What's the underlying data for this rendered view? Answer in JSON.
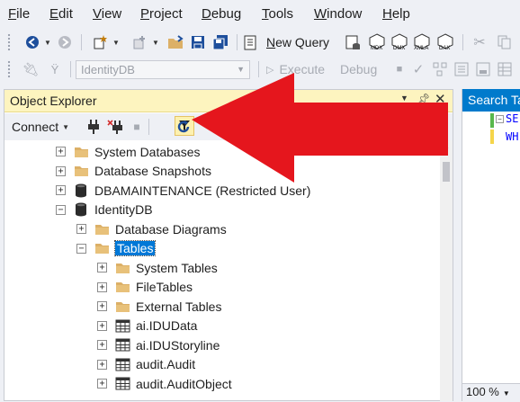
{
  "menu": [
    {
      "label": "File",
      "mnemonic": "F",
      "rest": "ile"
    },
    {
      "label": "Edit",
      "mnemonic": "E",
      "rest": "dit"
    },
    {
      "label": "View",
      "mnemonic": "V",
      "rest": "iew"
    },
    {
      "label": "Project",
      "mnemonic": "P",
      "rest": "roject"
    },
    {
      "label": "Debug",
      "mnemonic": "D",
      "rest": "ebug"
    },
    {
      "label": "Tools",
      "mnemonic": "T",
      "rest": "ools"
    },
    {
      "label": "Window",
      "mnemonic": "W",
      "rest": "indow"
    },
    {
      "label": "Help",
      "mnemonic": "H",
      "rest": "elp"
    }
  ],
  "toolbar1": {
    "new_query": "New Query",
    "new_query_mnemonic": "N",
    "new_query_rest": "ew Query"
  },
  "toolbar2": {
    "database": "IdentityDB",
    "execute": "Execute",
    "execute_mnemonic": "x",
    "debug": "Debug"
  },
  "object_explorer": {
    "title": "Object Explorer",
    "connect": "Connect",
    "tree": [
      {
        "label": "System Databases",
        "icon": "folder-icon",
        "expander": "+",
        "level": 0
      },
      {
        "label": "Database Snapshots",
        "icon": "folder-icon",
        "expander": "+",
        "level": 0
      },
      {
        "label": "DBAMAINTENANCE (Restricted User)",
        "icon": "database-icon",
        "expander": "+",
        "level": 0
      },
      {
        "label": "IdentityDB",
        "icon": "database-icon",
        "expander": "−",
        "level": 0
      },
      {
        "label": "Database Diagrams",
        "icon": "folder-icon",
        "expander": "+",
        "level": 1
      },
      {
        "label": "Tables",
        "icon": "folder-icon",
        "expander": "−",
        "level": 1,
        "selected": true
      },
      {
        "label": "System Tables",
        "icon": "folder-icon",
        "expander": "+",
        "level": 2
      },
      {
        "label": "FileTables",
        "icon": "folder-icon",
        "expander": "+",
        "level": 2
      },
      {
        "label": "External Tables",
        "icon": "folder-icon",
        "expander": "+",
        "level": 2
      },
      {
        "label": "ai.IDUData",
        "icon": "table-icon",
        "expander": "+",
        "level": 2
      },
      {
        "label": "ai.IDUStoryline",
        "icon": "table-icon",
        "expander": "+",
        "level": 2
      },
      {
        "label": "audit.Audit",
        "icon": "table-icon",
        "expander": "+",
        "level": 2
      },
      {
        "label": "audit.AuditObject",
        "icon": "table-icon",
        "expander": "+",
        "level": 2
      }
    ]
  },
  "document": {
    "tab_title": "Search Ta",
    "code_line1": "SE",
    "code_line2": "WH",
    "zoom": "100 %"
  },
  "colors": {
    "accent": "#007acc",
    "selection": "#0078d7",
    "header": "#fdf4bf",
    "annotation_arrow": "#e5161d"
  }
}
